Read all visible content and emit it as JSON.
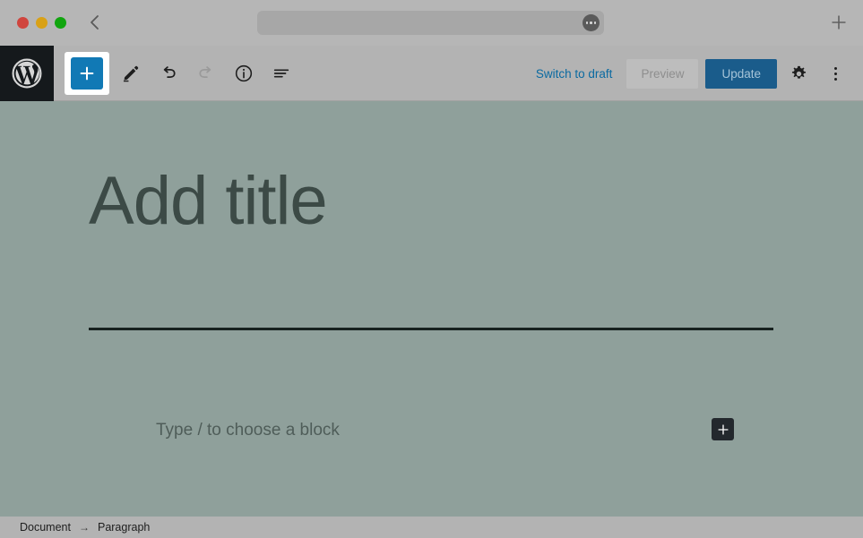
{
  "browser": {
    "traffic_lights": {
      "close_label": "close-window",
      "minimize_label": "minimize-window",
      "maximize_label": "maximize-window",
      "close_color": "#d0453e",
      "minimize_color": "#d9a116",
      "maximize_color": "#11a50f"
    },
    "back_label": "Back",
    "url_value": "",
    "url_placeholder": "",
    "url_menu_label": "Site settings",
    "new_tab_label": "New tab"
  },
  "toolbar": {
    "logo_label": "WordPress",
    "add_block_label": "Toggle block inserter",
    "tools_label": "Tools",
    "undo_label": "Undo",
    "redo_label": "Redo",
    "details_label": "Details",
    "list_view_label": "Document Overview",
    "switch_to_draft_label": "Switch to draft",
    "preview_label": "Preview",
    "update_label": "Update",
    "settings_label": "Settings",
    "options_label": "Options",
    "accent_link_color": "#0a6aa1",
    "update_button_color": "#1a5c8b",
    "add_block_color": "#1179b5"
  },
  "editor": {
    "title_placeholder": "Add title",
    "title_value": "",
    "paragraph_placeholder": "Type / to choose a block",
    "paragraph_value": "",
    "block_appender_label": "Add block",
    "canvas_color": "#8fa09b",
    "rule_color": "#17211f"
  },
  "footer": {
    "breadcrumb": [
      {
        "label": "Document"
      },
      {
        "label": "Paragraph"
      }
    ],
    "separator": "→"
  }
}
